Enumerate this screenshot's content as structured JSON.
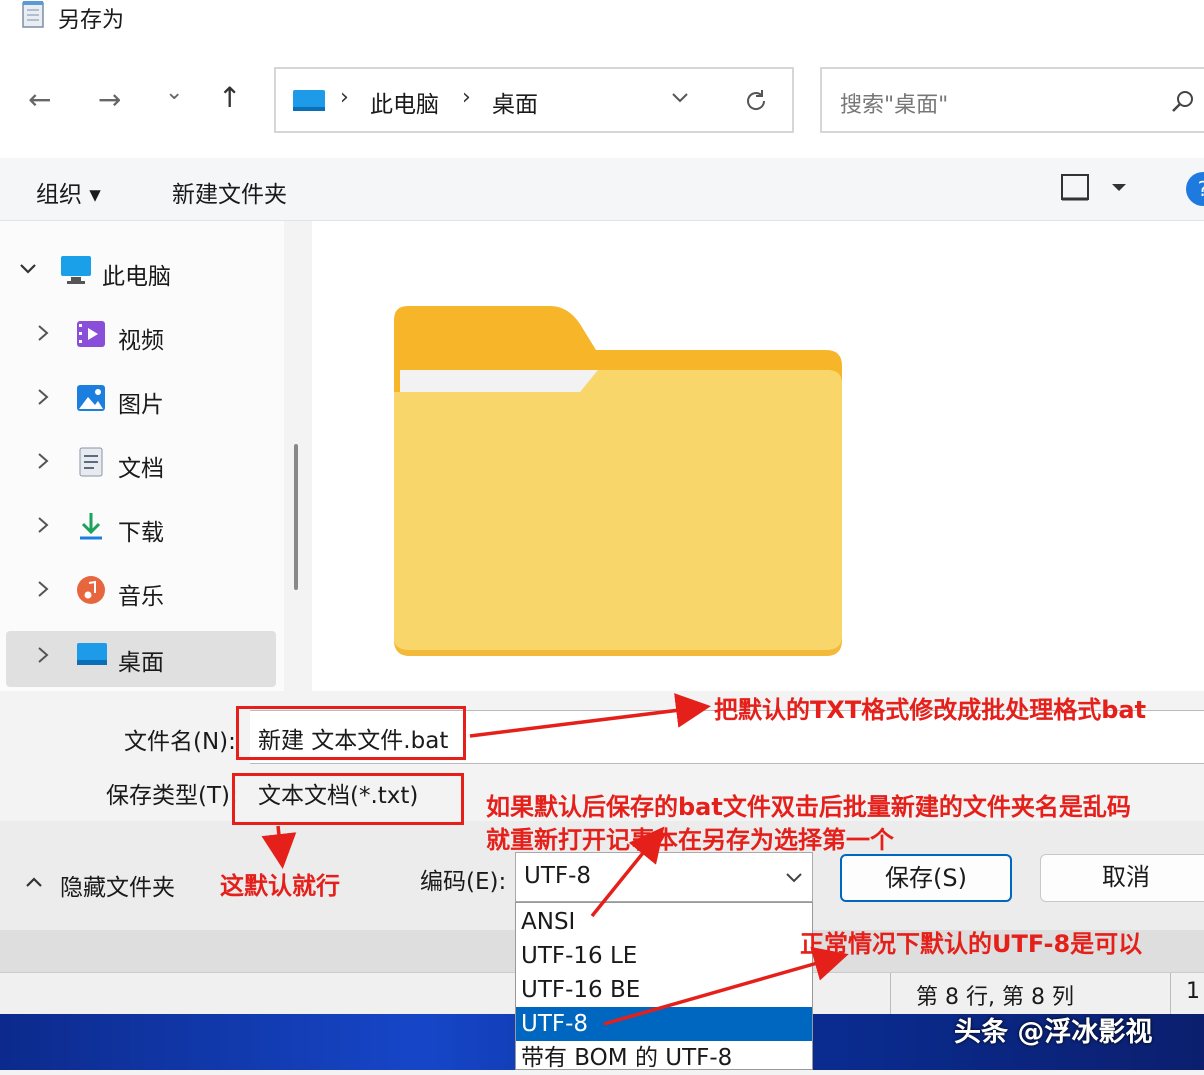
{
  "window": {
    "title": "另存为"
  },
  "nav": {
    "back": "←",
    "forward": "→",
    "recent": "⌄",
    "up": "↑",
    "breadcrumb": [
      "此电脑",
      "桌面"
    ],
    "separator": "›",
    "search_placeholder": "搜索\"桌面\""
  },
  "toolbar": {
    "organize": "组织 ▾",
    "new_folder": "新建文件夹",
    "help": "?"
  },
  "sidebar": {
    "items": [
      {
        "label": "此电脑",
        "icon": "monitor-icon"
      },
      {
        "label": "视频",
        "icon": "video-icon"
      },
      {
        "label": "图片",
        "icon": "pictures-icon"
      },
      {
        "label": "文档",
        "icon": "documents-icon"
      },
      {
        "label": "下载",
        "icon": "download-icon"
      },
      {
        "label": "音乐",
        "icon": "music-icon"
      },
      {
        "label": "桌面",
        "icon": "desktop-icon",
        "selected": true
      }
    ]
  },
  "form": {
    "filename_label": "文件名(N):",
    "filename_value": "新建 文本文件.bat",
    "filetype_label": "保存类型(T):",
    "filetype_value": "文本文档(*.txt)"
  },
  "footer": {
    "hide_folders": "隐藏文件夹",
    "encoding_label": "编码(E):",
    "encoding_value": "UTF-8",
    "save": "保存(S)",
    "cancel": "取消"
  },
  "encoding_options": [
    {
      "label": "ANSI"
    },
    {
      "label": "UTF-16 LE"
    },
    {
      "label": "UTF-16 BE"
    },
    {
      "label": "UTF-8",
      "selected": true
    },
    {
      "label": "带有 BOM 的 UTF-8"
    }
  ],
  "status": {
    "position": "第 8 行, 第 8 列",
    "partial": "1"
  },
  "annotations": {
    "a1": "把默认的TXT格式修改成批处理格式bat",
    "a2": "如果默认后保存的bat文件双击后批量新建的文件夹名是乱码",
    "a3": "就重新打开记事本在另存为选择第一个",
    "a4": "这默认就行",
    "a5": "正常情况下默认的UTF-8是可以"
  },
  "watermark": "头条 @浮冰影视",
  "colors": {
    "annotation": "#e5201b",
    "selection": "#0067c0",
    "folder": "#f9d66a"
  }
}
